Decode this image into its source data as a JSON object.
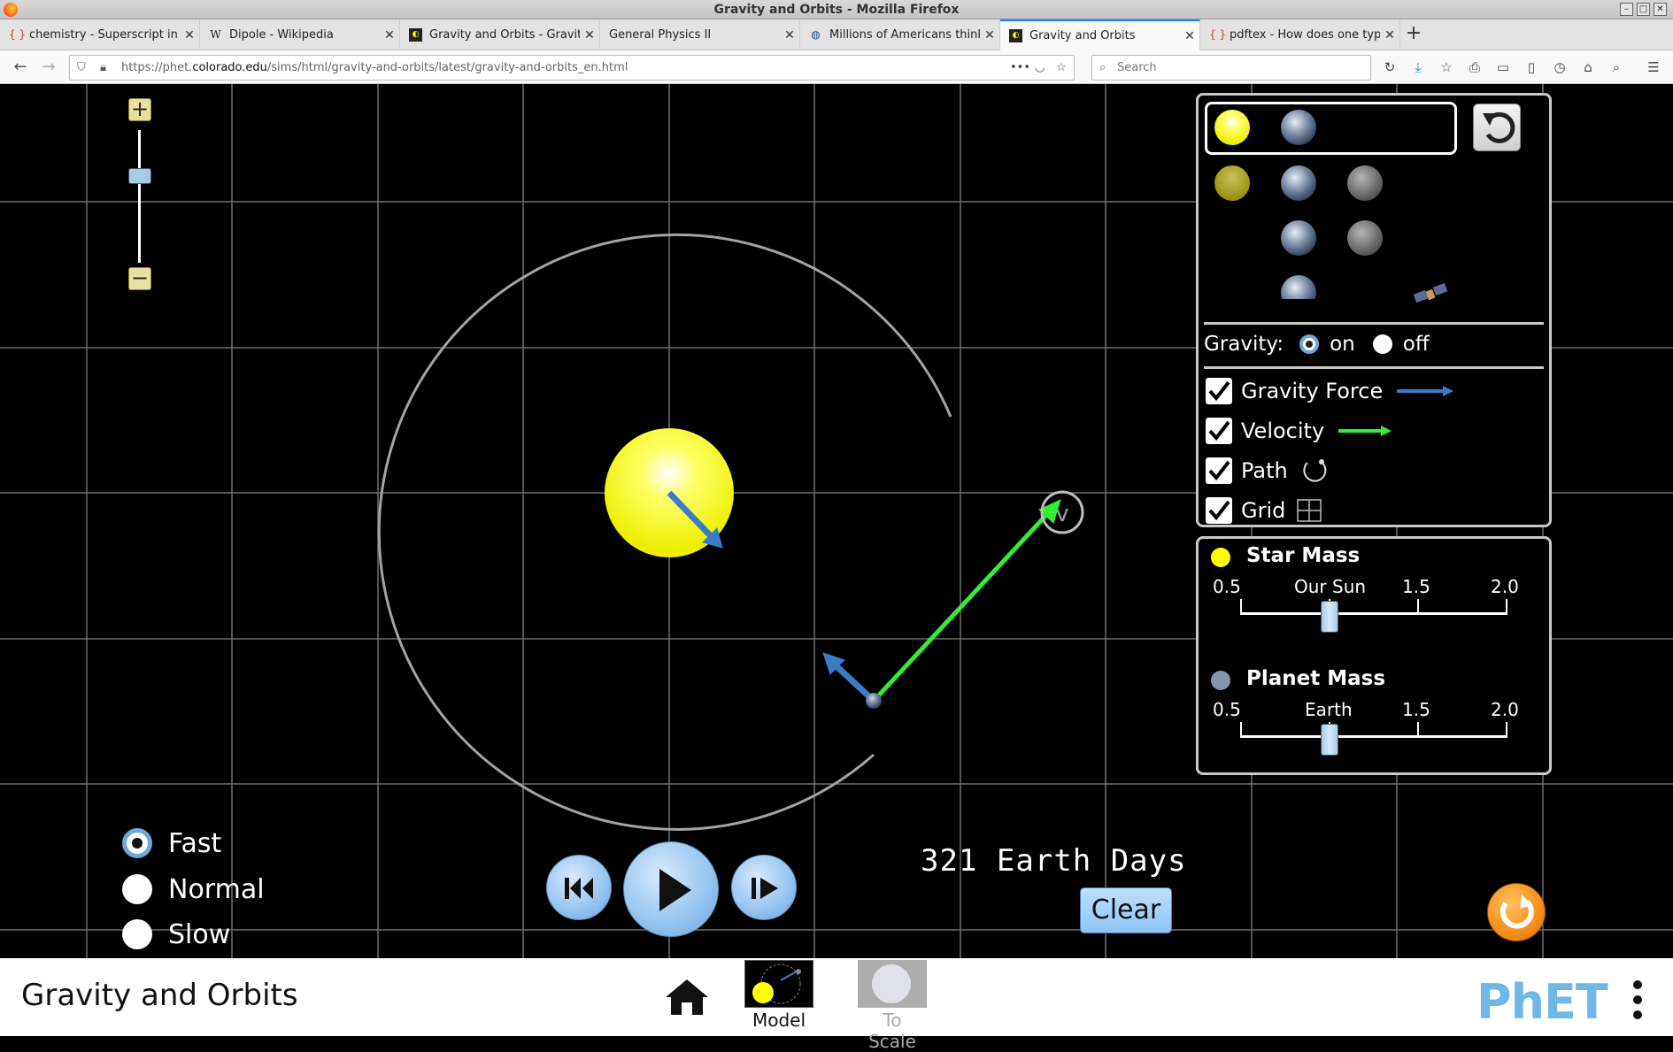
{
  "window": {
    "title": "Gravity and Orbits - Mozilla Firefox"
  },
  "tabs": [
    {
      "label": "chemistry - Superscript in u",
      "icon": "stackexchange-icon",
      "active": false
    },
    {
      "label": "Dipole - Wikipedia",
      "icon": "wikipedia-icon",
      "active": false
    },
    {
      "label": "Gravity and Orbits - Gravita",
      "icon": "phet-icon",
      "active": false
    },
    {
      "label": "General Physics II",
      "icon": "none",
      "active": false
    },
    {
      "label": "Millions of Americans think",
      "icon": "globe-icon",
      "active": false
    },
    {
      "label": "Gravity and Orbits",
      "icon": "phet-icon",
      "active": true
    },
    {
      "label": "pdftex - How does one type",
      "icon": "stackexchange-icon",
      "active": false
    }
  ],
  "nav": {
    "url_prefix": "https://phet.",
    "url_domain": "colorado.edu",
    "url_path": "/sims/html/gravity-and-orbits/latest/gravity-and-orbits_en.html",
    "search_placeholder": "Search",
    "more": "•••"
  },
  "sim": {
    "gravity_label": "Gravity:",
    "gravity_on": "on",
    "gravity_off": "off",
    "gravity_value": "on",
    "checkboxes": [
      {
        "label": "Gravity Force",
        "checked": true,
        "icon": "blue-arrow-icon"
      },
      {
        "label": "Velocity",
        "checked": true,
        "icon": "green-arrow-icon"
      },
      {
        "label": "Path",
        "checked": true,
        "icon": "path-icon"
      },
      {
        "label": "Grid",
        "checked": true,
        "icon": "grid-icon"
      }
    ],
    "star_mass": {
      "title": "Star Mass",
      "ticks": [
        "0.5",
        "Our Sun",
        "1.5",
        "2.0"
      ],
      "value": 1.0
    },
    "planet_mass": {
      "title": "Planet Mass",
      "ticks": [
        "0.5",
        "Earth",
        "1.5",
        "2.0"
      ],
      "value": 1.0
    },
    "speed": {
      "options": [
        "Fast",
        "Normal",
        "Slow"
      ],
      "selected": "Fast"
    },
    "elapsed": "321 Earth Days",
    "clear_label": "Clear",
    "velocity_label": "v",
    "colors": {
      "star": "#ffff00",
      "gravity_arrow": "#3a7bc8",
      "velocity_arrow": "#33ee33",
      "path": "#9a9a9a",
      "grid": "#777777"
    }
  },
  "bottom": {
    "sim_title": "Gravity and Orbits",
    "screens": [
      {
        "label": "Model",
        "selected": true
      },
      {
        "label": "To Scale",
        "selected": false
      }
    ],
    "logo": "PhET"
  }
}
